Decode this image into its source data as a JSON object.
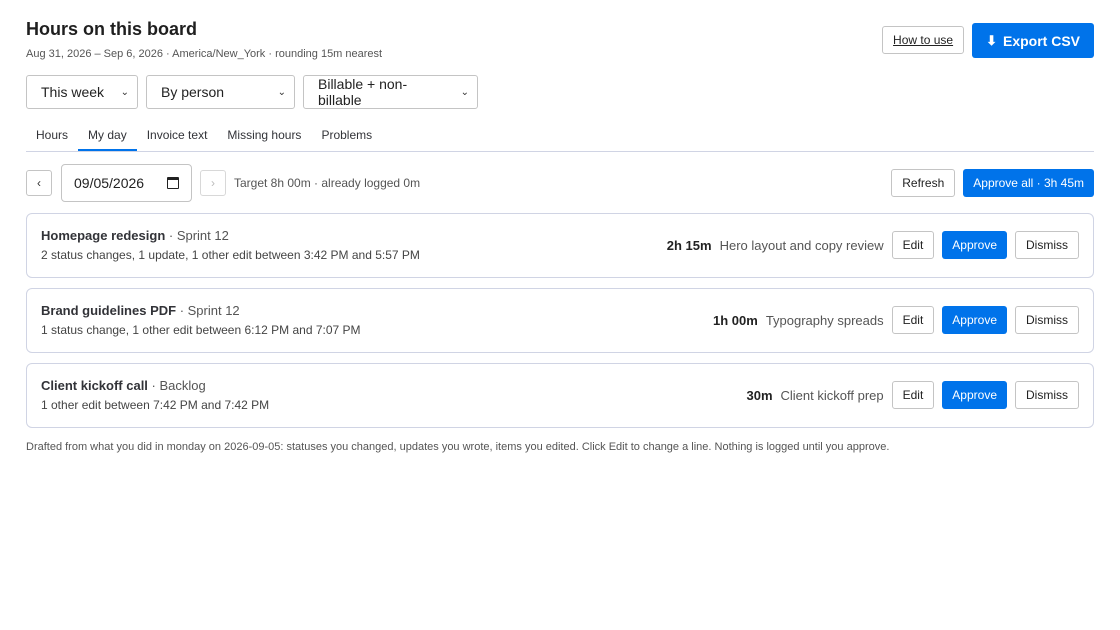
{
  "header": {
    "title": "Hours on this board",
    "subtitle": "Aug 31, 2026 – Sep 6, 2026 · America/New_York · rounding 15m nearest",
    "how_to_use": "How to use",
    "export_csv": "Export CSV",
    "export_icon": "⬇"
  },
  "filters": {
    "period": "This week",
    "group_by": "By person",
    "billable": "Billable + non-billable",
    "chevron": "⌄"
  },
  "tabs": [
    {
      "label": "Hours"
    },
    {
      "label": "My day"
    },
    {
      "label": "Invoice text"
    },
    {
      "label": "Missing hours"
    },
    {
      "label": "Problems"
    }
  ],
  "date_row": {
    "prev": "‹",
    "next": "›",
    "date": "09/05/2026",
    "target": "Target 8h 00m · already logged 0m",
    "refresh": "Refresh",
    "approve_all": "Approve all · 3h 45m"
  },
  "entries": [
    {
      "name": "Homepage redesign",
      "sprint": " · Sprint 12",
      "desc": "2 status changes, 1 update, 1 other edit between 3:42 PM and 5:57 PM",
      "duration": "2h 15m",
      "note": "Hero layout and copy review",
      "edit": "Edit",
      "approve": "Approve",
      "dismiss": "Dismiss"
    },
    {
      "name": "Brand guidelines PDF",
      "sprint": " · Sprint 12",
      "desc": "1 status change, 1 other edit between 6:12 PM and 7:07 PM",
      "duration": "1h 00m",
      "note": "Typography spreads",
      "edit": "Edit",
      "approve": "Approve",
      "dismiss": "Dismiss"
    },
    {
      "name": "Client kickoff call",
      "sprint": " · Backlog",
      "desc": "1 other edit between 7:42 PM and 7:42 PM",
      "duration": "30m",
      "note": "Client kickoff prep",
      "edit": "Edit",
      "approve": "Approve",
      "dismiss": "Dismiss"
    }
  ],
  "footnote": "Drafted from what you did in monday on 2026-09-05: statuses you changed, updates you wrote, items you edited. Click Edit to change a line. Nothing is logged until you approve.",
  "colors": {
    "primary": "#0073ea",
    "border": "#d0d4e4"
  }
}
